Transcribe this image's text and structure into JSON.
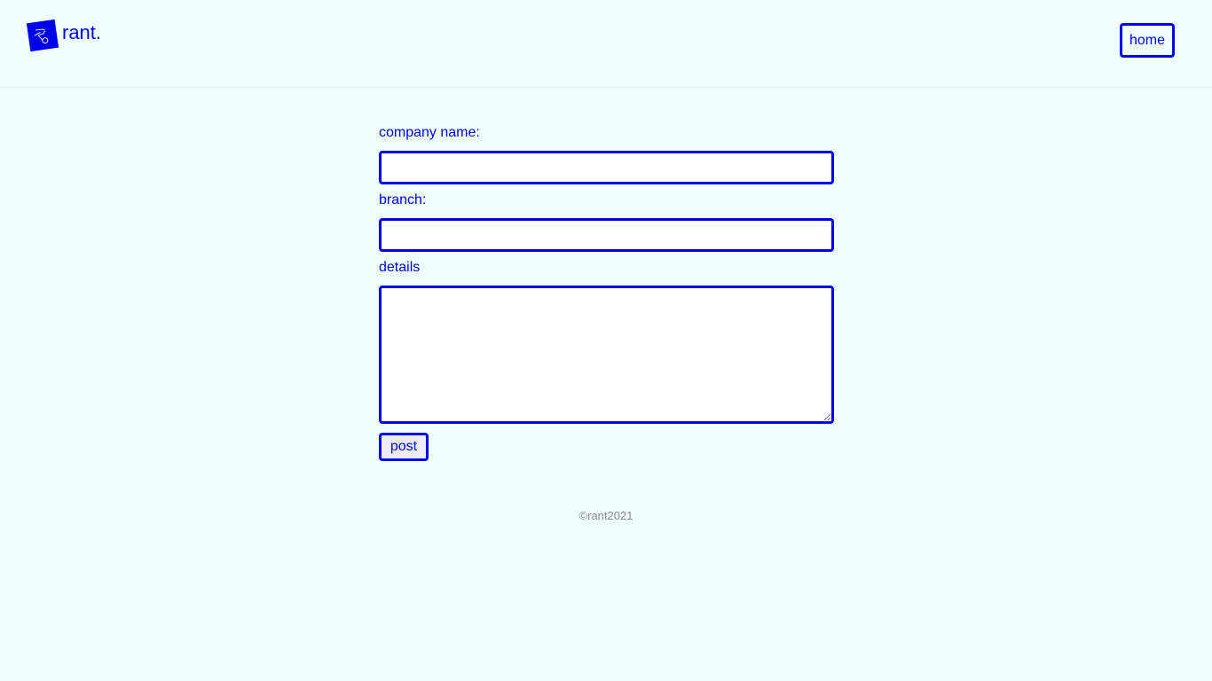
{
  "header": {
    "brand": "rant.",
    "logo_icon": "rant-logo-icon",
    "home_label": "home"
  },
  "form": {
    "company_label": "company name:",
    "company_value": "",
    "branch_label": "branch:",
    "branch_value": "",
    "details_label": "details",
    "details_value": "",
    "post_label": "post"
  },
  "footer": {
    "copyright": "©rant2021"
  },
  "colors": {
    "accent": "#0000ee",
    "background": "#effffe",
    "footer_text": "#8a8a8a"
  }
}
